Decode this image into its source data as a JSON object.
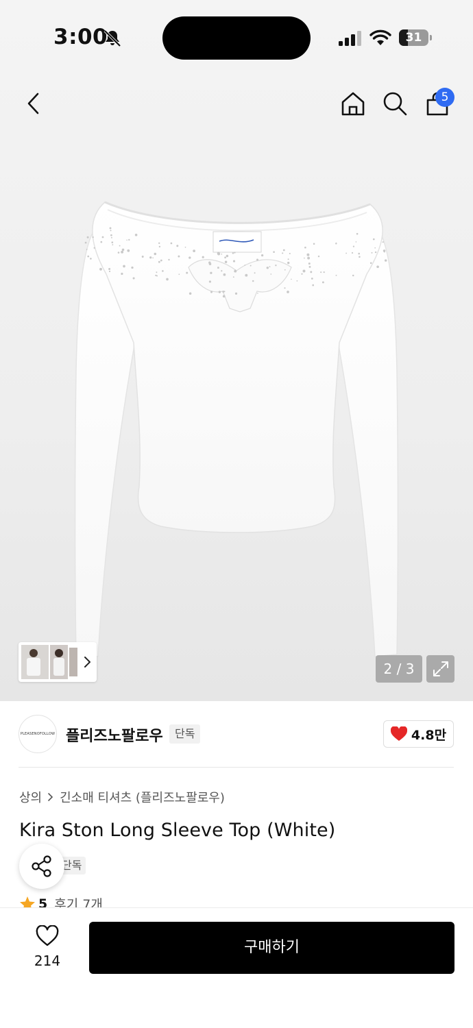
{
  "status_bar": {
    "time": "3:00",
    "battery_level": "31",
    "icons": [
      "bell-slash-icon",
      "signal-icon",
      "wifi-icon",
      "battery-icon"
    ]
  },
  "header": {
    "icons": [
      "chevron-left-icon",
      "home-icon",
      "search-icon",
      "shopping-bag-icon"
    ],
    "cart_badge": "5"
  },
  "gallery": {
    "page_indicator": "2 / 3",
    "expand_icon": "expand-icon",
    "thumbnail_chevron": "chevron-right-icon"
  },
  "brand": {
    "logo_text": "PLEASENOFOLLOW",
    "name": "플리즈노팔로우",
    "tag": "단독",
    "like_count": "4.8만",
    "heart_color": "#e52727"
  },
  "product": {
    "breadcrumb": [
      "상의",
      "긴소매 티셔츠 (플리즈노팔로우)"
    ],
    "title": "Kira Ston Long Sleeve Top (White)",
    "tag": "단독",
    "rating": "5",
    "review_label": "후기 7개",
    "star_color": "#f5a623"
  },
  "bottom_bar": {
    "wish_count": "214",
    "buy_label": "구매하기"
  }
}
